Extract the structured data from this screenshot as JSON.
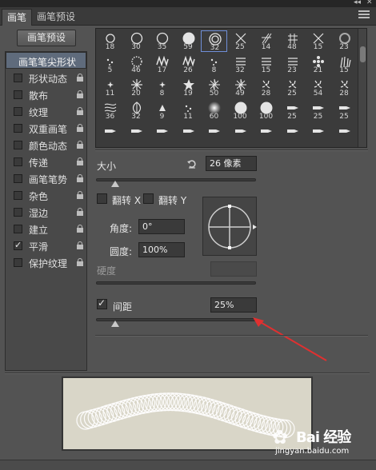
{
  "tabs": [
    {
      "label": "画笔",
      "active": true
    },
    {
      "label": "画笔预设",
      "active": false
    }
  ],
  "topstrip": {
    "collapse_glyph": "◂◂",
    "close_glyph": "✕"
  },
  "preset_button": "画笔预设",
  "sidebar": {
    "header": "画笔笔尖形状",
    "items": [
      {
        "label": "形状动态",
        "checked": false,
        "locked": true
      },
      {
        "label": "散布",
        "checked": false,
        "locked": true
      },
      {
        "label": "纹理",
        "checked": false,
        "locked": true
      },
      {
        "label": "双重画笔",
        "checked": false,
        "locked": true
      },
      {
        "label": "颜色动态",
        "checked": false,
        "locked": true
      },
      {
        "label": "传递",
        "checked": false,
        "locked": true
      },
      {
        "label": "画笔笔势",
        "checked": false,
        "locked": true
      },
      {
        "label": "杂色",
        "checked": false,
        "locked": true
      },
      {
        "label": "湿边",
        "checked": false,
        "locked": true
      },
      {
        "label": "建立",
        "checked": false,
        "locked": true
      },
      {
        "label": "平滑",
        "checked": true,
        "locked": true
      },
      {
        "label": "保护纹理",
        "checked": false,
        "locked": true
      }
    ]
  },
  "brush_grid": {
    "selected_index": 4,
    "tips": [
      {
        "size": "18",
        "icon": "hard-round-small-icon"
      },
      {
        "size": "30",
        "icon": "hard-round-icon"
      },
      {
        "size": "35",
        "icon": "hard-round-icon"
      },
      {
        "size": "59",
        "icon": "hard-round-large-icon"
      },
      {
        "size": "32",
        "icon": "double-ring-icon"
      },
      {
        "size": "25",
        "icon": "cross-icon"
      },
      {
        "size": "14",
        "icon": "hatch-icon"
      },
      {
        "size": "48",
        "icon": "grid-icon"
      },
      {
        "size": "15",
        "icon": "cross-icon"
      },
      {
        "size": "23",
        "icon": "ring-icon"
      },
      {
        "size": "5",
        "icon": "dots-icon"
      },
      {
        "size": "46",
        "icon": "dotted-ring-icon"
      },
      {
        "size": "17",
        "icon": "zigzag-icon"
      },
      {
        "size": "26",
        "icon": "zigzag-icon"
      },
      {
        "size": "8",
        "icon": "dots-icon"
      },
      {
        "size": "32",
        "icon": "brush-stroke-icon"
      },
      {
        "size": "15",
        "icon": "brush-stroke-icon"
      },
      {
        "size": "23",
        "icon": "brush-stroke-icon"
      },
      {
        "size": "21",
        "icon": "flower-icon"
      },
      {
        "size": "15",
        "icon": "grass-icon"
      },
      {
        "size": "11",
        "icon": "star-small-icon"
      },
      {
        "size": "20",
        "icon": "snowflake-icon"
      },
      {
        "size": "8",
        "icon": "star-small-icon"
      },
      {
        "size": "19",
        "icon": "star-icon"
      },
      {
        "size": "50",
        "icon": "starburst-icon"
      },
      {
        "size": "49",
        "icon": "starburst-icon"
      },
      {
        "size": "28",
        "icon": "scatter-icon"
      },
      {
        "size": "25",
        "icon": "scatter-icon"
      },
      {
        "size": "54",
        "icon": "scatter-icon"
      },
      {
        "size": "28",
        "icon": "scatter-icon"
      },
      {
        "size": "36",
        "icon": "scribble-icon"
      },
      {
        "size": "32",
        "icon": "leaf-icon"
      },
      {
        "size": "9",
        "icon": "triangle-icon"
      },
      {
        "size": "11",
        "icon": "dots-icon"
      },
      {
        "size": "60",
        "icon": "soft-round-icon"
      },
      {
        "size": "100",
        "icon": "hard-round-large-icon"
      },
      {
        "size": "100",
        "icon": "hard-round-large-icon"
      },
      {
        "size": "25",
        "icon": "brush-tip-icon"
      },
      {
        "size": "25",
        "icon": "brush-tip-icon"
      },
      {
        "size": "25",
        "icon": "brush-tip-icon"
      },
      {
        "size": "",
        "icon": "brush-tip-icon"
      },
      {
        "size": "",
        "icon": "brush-tip-icon"
      },
      {
        "size": "",
        "icon": "brush-tip-icon"
      },
      {
        "size": "",
        "icon": "brush-tip-icon"
      },
      {
        "size": "",
        "icon": "brush-tip-icon"
      },
      {
        "size": "",
        "icon": "brush-tip-icon"
      },
      {
        "size": "",
        "icon": "brush-tip-icon"
      },
      {
        "size": "",
        "icon": "brush-tip-icon"
      },
      {
        "size": "",
        "icon": "brush-tip-icon"
      },
      {
        "size": "",
        "icon": "brush-tip-icon"
      }
    ]
  },
  "size": {
    "label": "大小",
    "value": "26 像素",
    "reset_icon": "reset-icon",
    "slider_fraction": 0.12
  },
  "flip": {
    "x_label": "翻转 X",
    "y_label": "翻转 Y",
    "x_checked": false,
    "y_checked": false
  },
  "angle": {
    "label": "角度:",
    "value": "0°"
  },
  "roundness": {
    "label": "圆度:",
    "value": "100%"
  },
  "hardness": {
    "label": "硬度",
    "value": "",
    "disabled": true
  },
  "spacing": {
    "label": "间距",
    "checked": true,
    "value": "25%",
    "slider_fraction": 0.12
  },
  "colors": {
    "panel": "#535353",
    "dark": "#3a3a3a",
    "accent": "#6f8fd8",
    "arrow": "#e03030"
  },
  "watermark": {
    "text": "Bai 经验",
    "url_text": "jingyan.baidu.com"
  }
}
